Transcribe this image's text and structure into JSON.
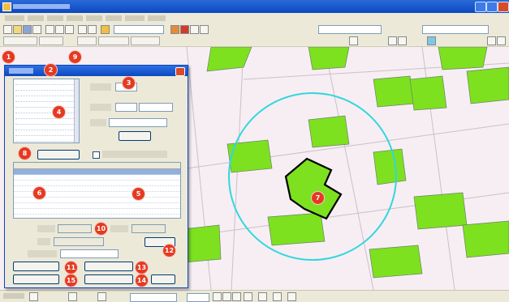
{
  "colors": {
    "titlebar": "#0b48c0",
    "chrome": "#ece9d8",
    "map_background": "#f7eef3",
    "parcel_fill": "#7de11f",
    "parcel_stroke": "#6e7f6e",
    "road_stroke": "#c9c1c8",
    "search_circle": "#31d7de",
    "selected_parcel_stroke": "#000000",
    "callout": "#e53a22"
  },
  "icons": [
    "app-icon",
    "minimize-icon",
    "maximize-icon",
    "close-icon",
    "new-file-icon",
    "open-icon",
    "save-icon",
    "print-icon",
    "cut-icon",
    "copy-icon",
    "paste-icon",
    "undo-icon",
    "redo-icon",
    "add-data-icon",
    "pan-icon",
    "zoom-in-icon",
    "zoom-out-icon",
    "full-extent-icon",
    "identify-icon",
    "select-features-icon",
    "dialog-close-icon"
  ],
  "callouts": [
    "1",
    "2",
    "3",
    "4",
    "5",
    "6",
    "7",
    "8",
    "9",
    "10",
    "11",
    "12",
    "13",
    "14",
    "15"
  ]
}
